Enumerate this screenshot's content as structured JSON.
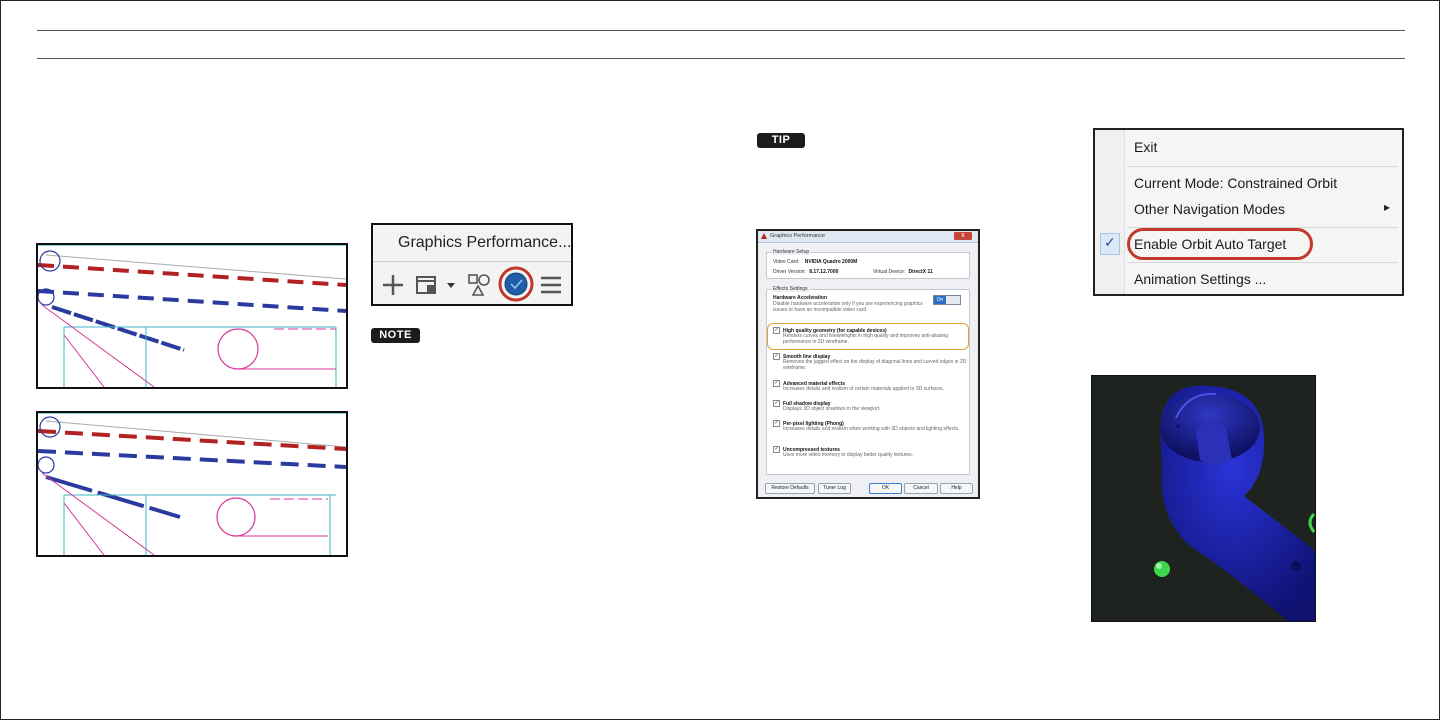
{
  "toolbar": {
    "title": "Graphics Performance...",
    "icons": [
      "plus-icon",
      "viewport-lock-icon",
      "dropdown-arrow-icon",
      "isolate-objects-icon",
      "hardware-acceleration-icon",
      "menu-icon"
    ]
  },
  "note_label": "NOTE",
  "tip_label": "TIP",
  "dialog": {
    "title": "Graphics Performance",
    "close": "x",
    "hardware_group": {
      "title": "Hardware Setup",
      "video_card_label": "Video Card:",
      "video_card_value": "NVIDIA Quadro 2000M",
      "driver_label": "Driver Version:",
      "driver_value": "8.17.12.7000",
      "virtual_device_label": "Virtual Device:",
      "virtual_device_value": "DirectX 11"
    },
    "effects_group": {
      "title": "Effects Settings",
      "hw_accel_title": "Hardware Acceleration",
      "hw_accel_desc": "Disable hardware acceleration only if you are experiencing graphics issues or have an incompatible video card.",
      "toggle_label": "On",
      "options": [
        {
          "title": "High quality geometry (for capable devices)",
          "desc": "Renders curves and linewiehghts in high quality and improves anti-aliasing performance in 2D wireframe.",
          "checked": true
        },
        {
          "title": "Smooth line display",
          "desc": "Removes the jagged effect on the display of diagonal lines and curved edges in 2D wireframe.",
          "checked": true
        },
        {
          "title": "Advanced material effects",
          "desc": "Increases details and realism of certain materials applied to 3D surfaces.",
          "checked": true
        },
        {
          "title": "Full shadow display",
          "desc": "Displays 3D object shadows in the viewport.",
          "checked": true
        },
        {
          "title": "Per-pixel lighting (Phong)",
          "desc": "Increases details and realism when working with 3D objects and lighting effects.",
          "checked": true
        },
        {
          "title": "Uncompressed textures",
          "desc": "Uses more video memory to display better quality textures.",
          "checked": true
        }
      ]
    },
    "buttons": {
      "restore": "Restore Defaults",
      "tuner": "Tuner Log",
      "ok": "OK",
      "cancel": "Cancel",
      "help": "Help"
    }
  },
  "context_menu": {
    "exit": "Exit",
    "current_mode": "Current Mode: Constrained Orbit",
    "other_modes": "Other Navigation Modes",
    "enable_auto_target": "Enable Orbit Auto Target",
    "animation_settings": "Animation Settings ...",
    "check_mark": "✓",
    "submenu_arrow": "▸"
  },
  "colors": {
    "highlight_red": "#c0392b",
    "highlight_orange": "#e4a23a",
    "cad_red": "#b22222",
    "cad_blue": "#2b3a9e",
    "cad_cyan": "#3fb6c8",
    "cad_magenta": "#d63a9a",
    "model_blue": "#1b1fa0",
    "model_green": "#3ed64a"
  }
}
